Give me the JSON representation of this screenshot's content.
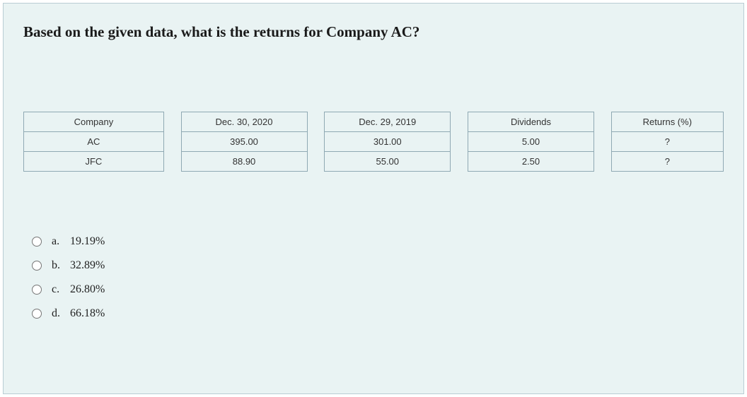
{
  "question": "Based on the given data, what is the returns for Company AC?",
  "table": {
    "headers": [
      "Company",
      "Dec. 30, 2020",
      "Dec. 29, 2019",
      "Dividends",
      "Returns (%)"
    ],
    "rows": [
      {
        "c0": "AC",
        "c1": "395.00",
        "c2": "301.00",
        "c3": "5.00",
        "c4": "?"
      },
      {
        "c0": "JFC",
        "c1": "88.90",
        "c2": "55.00",
        "c3": "2.50",
        "c4": "?"
      }
    ]
  },
  "options": [
    {
      "letter": "a.",
      "text": "19.19%"
    },
    {
      "letter": "b.",
      "text": "32.89%"
    },
    {
      "letter": "c.",
      "text": "26.80%"
    },
    {
      "letter": "d.",
      "text": "66.18%"
    }
  ]
}
